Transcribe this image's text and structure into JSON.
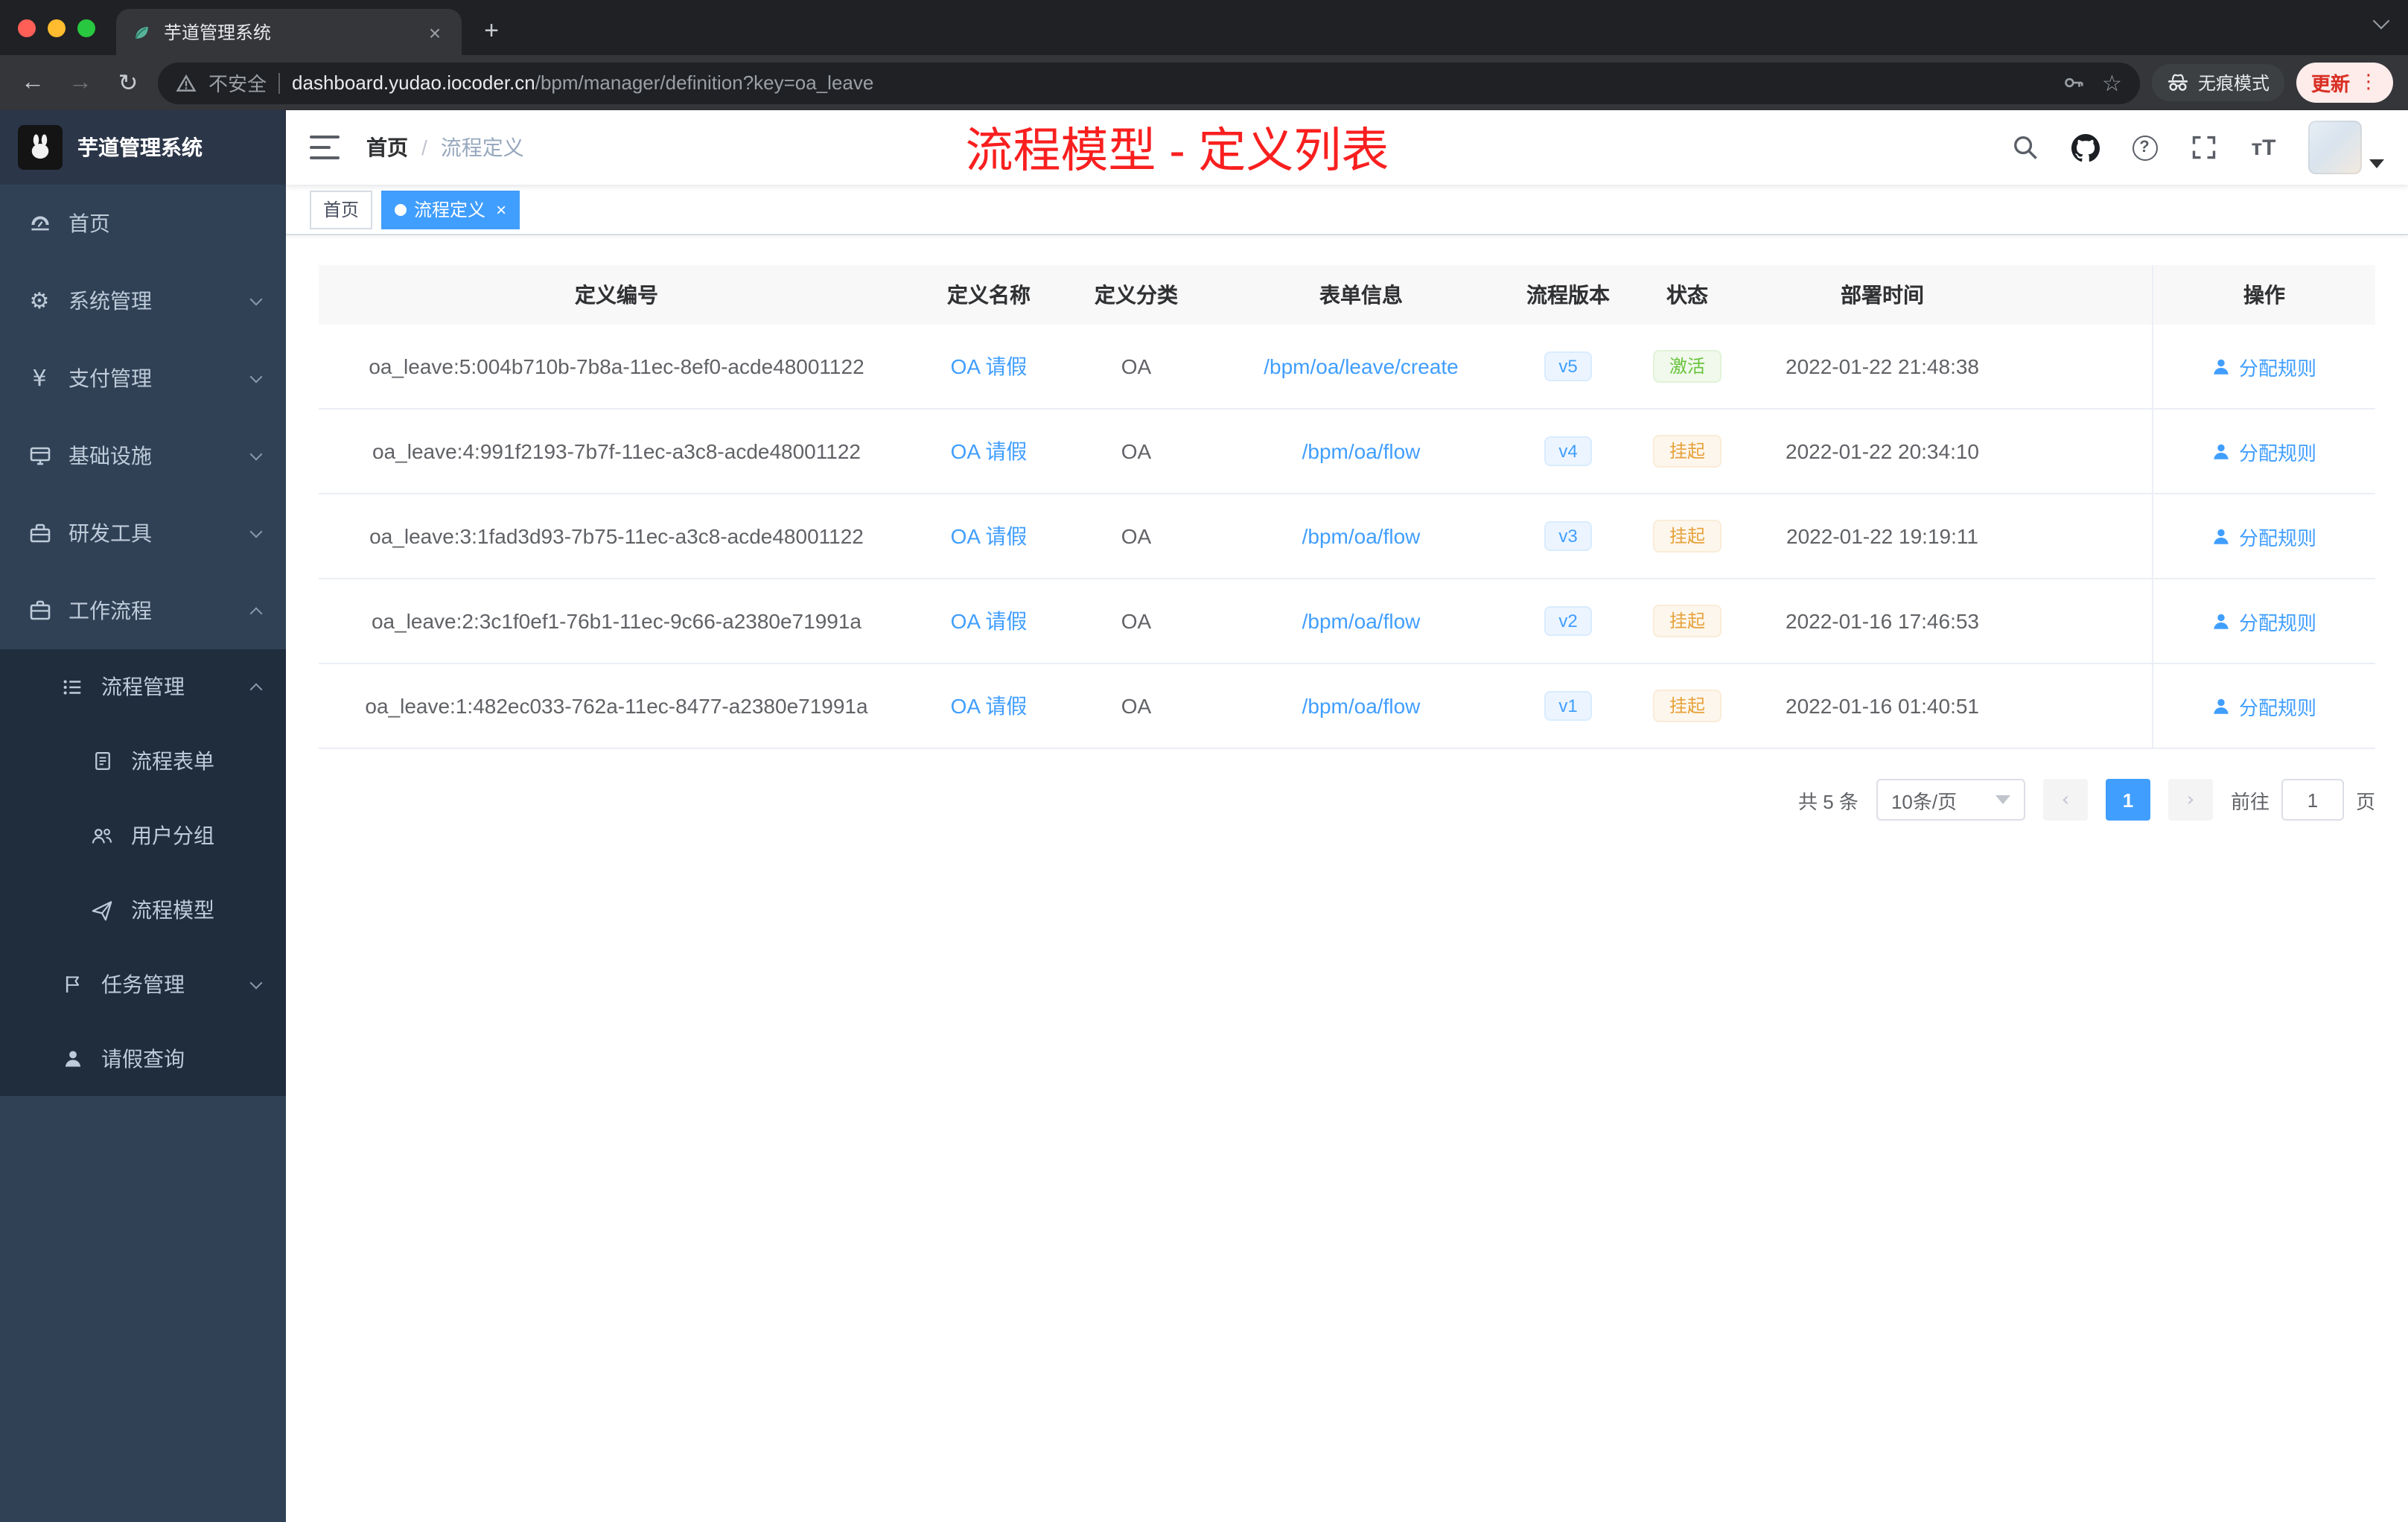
{
  "colors": {
    "accent": "#409eff",
    "success": "#67c23a",
    "warning": "#e6a23c",
    "annotation_red": "#f91f1f",
    "sidebar_bg": "#304156",
    "sidebar_sub_bg": "#1f2d3d"
  },
  "glyphs": {
    "close": "×",
    "plus": "+",
    "back": "←",
    "forward": "→",
    "reload": "↻",
    "star": "☆",
    "dots": "⋮",
    "gear": "⚙",
    "yen": "¥",
    "question": "?",
    "fontsize": "тT",
    "pager_prev": "‹",
    "pager_next": "›"
  },
  "browser": {
    "tab_title": "芋道管理系统",
    "security_label": "不安全",
    "url_domain": "dashboard.yudao.iocoder.cn",
    "url_path": "/bpm/manager/definition?key=oa_leave",
    "incognito_label": "无痕模式",
    "update_label": "更新"
  },
  "sidebar": {
    "title": "芋道管理系统",
    "items": [
      {
        "label": "首页",
        "icon": "dashboard-icon"
      },
      {
        "label": "系统管理",
        "icon": "gear-icon"
      },
      {
        "label": "支付管理",
        "icon": "yen-icon"
      },
      {
        "label": "基础设施",
        "icon": "infrastructure-icon"
      },
      {
        "label": "研发工具",
        "icon": "devtools-icon"
      },
      {
        "label": "工作流程",
        "icon": "briefcase-icon"
      },
      {
        "label": "流程管理",
        "icon": "process-list-icon"
      },
      {
        "label": "流程表单",
        "icon": "form-icon"
      },
      {
        "label": "用户分组",
        "icon": "user-group-icon"
      },
      {
        "label": "流程模型",
        "icon": "paper-plane-icon"
      },
      {
        "label": "任务管理",
        "icon": "task-flag-icon"
      },
      {
        "label": "请假查询",
        "icon": "person-icon"
      }
    ]
  },
  "header": {
    "breadcrumb_home": "首页",
    "breadcrumb_separator": "/",
    "breadcrumb_current": "流程定义",
    "annotation": "流程模型 - 定义列表"
  },
  "tags": {
    "home": "首页",
    "current": "流程定义"
  },
  "table": {
    "columns": [
      "定义编号",
      "定义名称",
      "定义分类",
      "表单信息",
      "流程版本",
      "状态",
      "部署时间",
      "操作"
    ],
    "rows": [
      {
        "id": "oa_leave:5:004b710b-7b8a-11ec-8ef0-acde48001122",
        "name": "OA 请假",
        "category": "OA",
        "form": "/bpm/oa/leave/create",
        "version": "v5",
        "status": "激活",
        "status_type": "success",
        "deploy_time": "2022-01-22 21:48:38",
        "action": "分配规则"
      },
      {
        "id": "oa_leave:4:991f2193-7b7f-11ec-a3c8-acde48001122",
        "name": "OA 请假",
        "category": "OA",
        "form": "/bpm/oa/flow",
        "version": "v4",
        "status": "挂起",
        "status_type": "warning",
        "deploy_time": "2022-01-22 20:34:10",
        "action": "分配规则"
      },
      {
        "id": "oa_leave:3:1fad3d93-7b75-11ec-a3c8-acde48001122",
        "name": "OA 请假",
        "category": "OA",
        "form": "/bpm/oa/flow",
        "version": "v3",
        "status": "挂起",
        "status_type": "warning",
        "deploy_time": "2022-01-22 19:19:11",
        "action": "分配规则"
      },
      {
        "id": "oa_leave:2:3c1f0ef1-76b1-11ec-9c66-a2380e71991a",
        "name": "OA 请假",
        "category": "OA",
        "form": "/bpm/oa/flow",
        "version": "v2",
        "status": "挂起",
        "status_type": "warning",
        "deploy_time": "2022-01-16 17:46:53",
        "action": "分配规则"
      },
      {
        "id": "oa_leave:1:482ec033-762a-11ec-8477-a2380e71991a",
        "name": "OA 请假",
        "category": "OA",
        "form": "/bpm/oa/flow",
        "version": "v1",
        "status": "挂起",
        "status_type": "warning",
        "deploy_time": "2022-01-16 01:40:51",
        "action": "分配规则"
      }
    ]
  },
  "pagination": {
    "total_label": "共 5 条",
    "page_size_label": "10条/页",
    "current_page": "1",
    "goto_label": "前往",
    "goto_value": "1",
    "page_unit": "页"
  }
}
